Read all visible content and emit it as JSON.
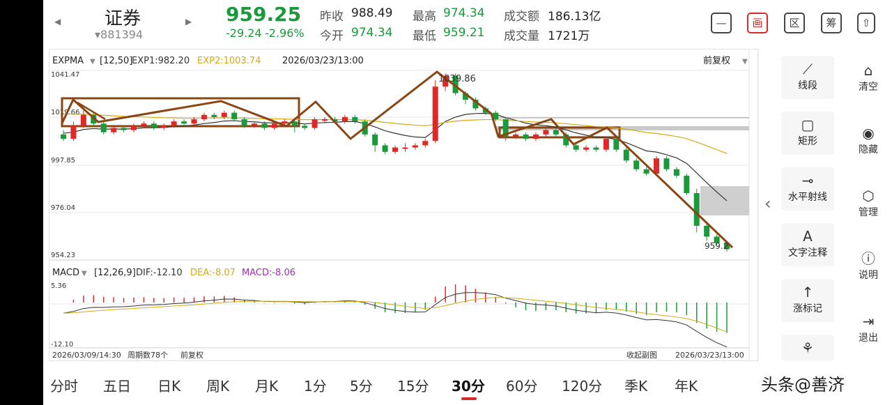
{
  "header": {
    "prev_arrow": "◀",
    "next_arrow": "▶",
    "stock_name": "证券",
    "stock_code": "▾881394",
    "price": "959.25",
    "change": "-29.24",
    "change_pct": "-2.96%",
    "prev_close_label": "昨收",
    "prev_close": "988.49",
    "open_label": "今开",
    "open": "974.34",
    "high_label": "最高",
    "high": "974.34",
    "low_label": "最低",
    "low": "959.21",
    "amount_label": "成交额",
    "amount": "186.13亿",
    "volume_label": "成交量",
    "volume": "1721万"
  },
  "toolbar_icons": [
    "minus-box-icon",
    "draw-icon",
    "region-icon",
    "chip-icon",
    "share-icon"
  ],
  "toolbar": {
    "draw_glyph": "画",
    "region_glyph": "区",
    "chip_glyph": "筹"
  },
  "main_chart": {
    "indicator": "EXPMA",
    "params": "[12,50]",
    "exp1": "EXP1:982.20",
    "exp2": "EXP2:1003.74",
    "datetime": "2026/03/23/13:00",
    "adjust": "前复权",
    "y_ticks": [
      "1041.47",
      "1019.66",
      "997.85",
      "976.04",
      "954.23"
    ],
    "high_label": "1039.86",
    "last_label": "959.2"
  },
  "macd_chart": {
    "indicator": "MACD",
    "params": "[12,26,9]",
    "dif": "DIF:-12.10",
    "dea": "DEA:-8.07",
    "macd": "MACD:-8.06",
    "y_top": "5.36",
    "y_bottom": "-12.10",
    "start_date": "2026/03/09/14:30",
    "periods": "周期数78个",
    "adjust": "前复权",
    "collapse": "收起副图",
    "end_date": "2026/03/23/13:00"
  },
  "sidebar": {
    "tools": [
      {
        "label": "线段",
        "icon": "line-segment-icon"
      },
      {
        "label": "矩形",
        "icon": "rectangle-icon"
      },
      {
        "label": "水平射线",
        "icon": "horizontal-ray-icon"
      },
      {
        "label": "文字注释",
        "icon": "text-annotation-icon"
      },
      {
        "label": "涨标记",
        "icon": "up-mark-icon"
      }
    ],
    "actions": [
      {
        "label": "清空",
        "icon": "clear-icon"
      },
      {
        "label": "隐藏",
        "icon": "eye-icon"
      },
      {
        "label": "管理",
        "icon": "manage-icon"
      },
      {
        "label": "说明",
        "icon": "help-icon"
      },
      {
        "label": "退出",
        "icon": "exit-icon"
      }
    ],
    "collapse_arrow": "‹"
  },
  "periods": [
    "分时",
    "五日",
    "日K",
    "周K",
    "月K",
    "1分",
    "5分",
    "15分",
    "30分",
    "60分",
    "120分",
    "季K",
    "年K"
  ],
  "active_period": "30分",
  "watermark": "头条@善济",
  "colors": {
    "up": "#e02828",
    "down": "#1a9a3a",
    "exp1": "#333333",
    "exp2": "#d4aa10",
    "drawing": "#8b4513",
    "macd_purple": "#9b2bb3"
  },
  "chart_data": {
    "type": "candlestick",
    "ylim": [
      954.23,
      1041.47
    ],
    "candles": [
      [
        1012,
        1010,
        1014,
        1009
      ],
      [
        1010,
        1016,
        1018,
        1009
      ],
      [
        1016,
        1021,
        1023,
        1015
      ],
      [
        1021,
        1017,
        1022,
        1016
      ],
      [
        1017,
        1013,
        1018,
        1012
      ],
      [
        1013,
        1015,
        1016,
        1012
      ],
      [
        1015,
        1014,
        1016,
        1013
      ],
      [
        1014,
        1016,
        1017,
        1013
      ],
      [
        1016,
        1017,
        1018,
        1015
      ],
      [
        1017,
        1015,
        1018,
        1014
      ],
      [
        1015,
        1016,
        1017,
        1014
      ],
      [
        1016,
        1018,
        1019,
        1015
      ],
      [
        1018,
        1017,
        1019,
        1016
      ],
      [
        1017,
        1019,
        1020,
        1016
      ],
      [
        1019,
        1021,
        1022,
        1018
      ],
      [
        1021,
        1020,
        1022,
        1019
      ],
      [
        1020,
        1022,
        1023,
        1019
      ],
      [
        1022,
        1019,
        1023,
        1018
      ],
      [
        1019,
        1016,
        1020,
        1015
      ],
      [
        1016,
        1017,
        1018,
        1015
      ],
      [
        1017,
        1015,
        1018,
        1014
      ],
      [
        1015,
        1017,
        1018,
        1014
      ],
      [
        1017,
        1018,
        1019,
        1016
      ],
      [
        1018,
        1016,
        1019,
        1013
      ],
      [
        1016,
        1015,
        1017,
        1014
      ],
      [
        1015,
        1019,
        1020,
        1014
      ],
      [
        1019,
        1019,
        1020,
        1017
      ],
      [
        1019,
        1018,
        1020,
        1017
      ],
      [
        1018,
        1020,
        1021,
        1017
      ],
      [
        1020,
        1018,
        1021,
        1017
      ],
      [
        1018,
        1012,
        1019,
        1011
      ],
      [
        1012,
        1007,
        1013,
        1004
      ],
      [
        1007,
        1004,
        1008,
        1003
      ],
      [
        1004,
        1006,
        1007,
        1003
      ],
      [
        1006,
        1006,
        1008,
        1004
      ],
      [
        1006,
        1007,
        1008,
        1005
      ],
      [
        1007,
        1009,
        1010,
        1006
      ],
      [
        1009,
        1034,
        1037,
        1008
      ],
      [
        1034,
        1039,
        1040,
        1032
      ],
      [
        1039,
        1031,
        1040,
        1030
      ],
      [
        1031,
        1028,
        1032,
        1026
      ],
      [
        1028,
        1024,
        1029,
        1023
      ],
      [
        1024,
        1022,
        1025,
        1021
      ],
      [
        1022,
        1019,
        1023,
        1018
      ],
      [
        1019,
        1011,
        1020,
        1009
      ],
      [
        1011,
        1012,
        1013,
        1010
      ],
      [
        1012,
        1010,
        1013,
        1009
      ],
      [
        1010,
        1012,
        1013,
        1009
      ],
      [
        1012,
        1014,
        1015,
        1011
      ],
      [
        1014,
        1012,
        1015,
        1011
      ],
      [
        1012,
        1007,
        1013,
        1006
      ],
      [
        1007,
        1005,
        1008,
        1004
      ],
      [
        1005,
        1006,
        1007,
        1004
      ],
      [
        1006,
        1005,
        1007,
        1004
      ],
      [
        1005,
        1010,
        1011,
        1004
      ],
      [
        1010,
        1005,
        1011,
        1004
      ],
      [
        1005,
        1000,
        1006,
        999
      ],
      [
        1000,
        996,
        1001,
        995
      ],
      [
        996,
        994,
        997,
        993
      ],
      [
        994,
        1001,
        1002,
        993
      ],
      [
        1001,
        996,
        1002,
        995
      ],
      [
        996,
        993,
        997,
        992
      ],
      [
        993,
        985,
        994,
        984
      ],
      [
        985,
        970,
        987,
        967
      ],
      [
        970,
        965,
        971,
        963
      ],
      [
        965,
        962,
        966,
        961
      ],
      [
        962,
        959.2,
        963,
        958
      ]
    ]
  }
}
